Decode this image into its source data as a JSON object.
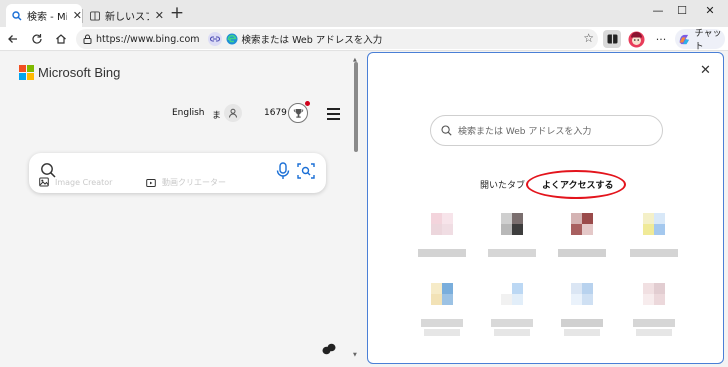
{
  "tabs": [
    {
      "label": "検索 - Micro",
      "icon": "search-icon"
    },
    {
      "label": "新しいスプリッ",
      "icon": "split-tab-icon"
    }
  ],
  "window_controls": {
    "minimize": "—",
    "maximize": "☐",
    "close": "✕"
  },
  "address_bar": {
    "url": "https://www.bing.com",
    "search_text": "検索または Web アドレスを入力"
  },
  "toolbar": {
    "more": "···",
    "copilot_label": "チャット"
  },
  "bing": {
    "logo_text": "Microsoft Bing",
    "language": "English",
    "user_initial": "ま",
    "points": "1679",
    "search_chips": [
      "Image Creator",
      "動画クリエーター"
    ]
  },
  "new_tab": {
    "search_placeholder": "検索または Web アドレスを入力",
    "tabs": [
      "開いたタブ",
      "よくアクセスする"
    ],
    "tiles": [
      {
        "colors": [
          "#f3d4dc",
          "#f7e4ea",
          "#ecd6dc",
          "#f0dde3"
        ],
        "cap": "#d3d3d3"
      },
      {
        "colors": [
          "#cfcfcf",
          "#7a6e6e",
          "#b8b8b8",
          "#3d3d3d"
        ],
        "cap": "#d6d6d6"
      },
      {
        "colors": [
          "#d4b3b3",
          "#9a4a4a",
          "#a86060",
          "#e4c8c8"
        ],
        "cap": "#d1d1d1"
      },
      {
        "colors": [
          "#f4f0c8",
          "#d8e8f8",
          "#f0ea98",
          "#a4c8ee"
        ],
        "cap": "#d4d4d4"
      },
      {
        "colors": [
          "#f6ebc8",
          "#7aaedc",
          "#f2e2b6",
          "#9cc2e4"
        ],
        "cap": "#d8d8d8"
      },
      {
        "colors": [
          "#ffffff",
          "#bcd8f4",
          "#f1f1f1",
          "#e2eef9"
        ],
        "cap": "#d9d9d9"
      },
      {
        "colors": [
          "#dbe6f4",
          "#b8d2ee",
          "#eaf2fb",
          "#cfe0f3"
        ],
        "cap": "#d0d0d0"
      },
      {
        "colors": [
          "#f1e0e2",
          "#e2cdd1",
          "#f7eced",
          "#ecd8db"
        ],
        "cap": "#d6d6d6"
      }
    ]
  },
  "colors": {
    "accent": "#4a7fd6",
    "annotation": "#e3141c",
    "notification": "#d0021b"
  }
}
